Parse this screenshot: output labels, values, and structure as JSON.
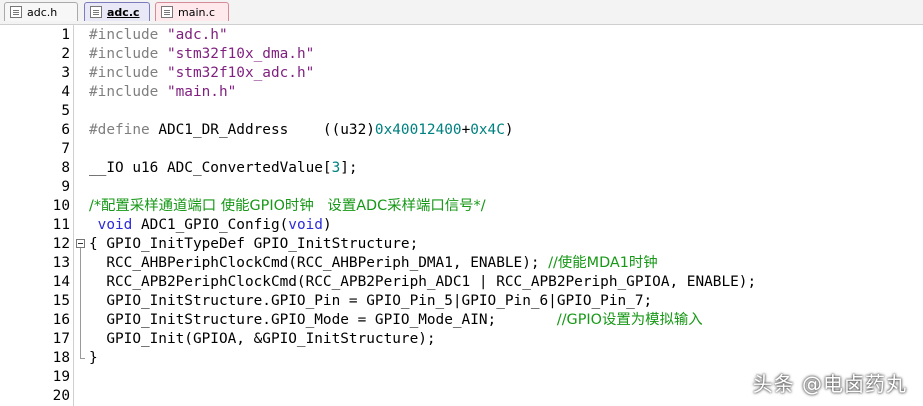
{
  "tabs": [
    {
      "label": "adc.h",
      "active": false
    },
    {
      "label": "adc.c",
      "active": true
    },
    {
      "label": "main.c",
      "active": false
    }
  ],
  "lines": [
    {
      "n": "1"
    },
    {
      "n": "2"
    },
    {
      "n": "3"
    },
    {
      "n": "4"
    },
    {
      "n": "5"
    },
    {
      "n": "6"
    },
    {
      "n": "7"
    },
    {
      "n": "8"
    },
    {
      "n": "9"
    },
    {
      "n": "10"
    },
    {
      "n": "11"
    },
    {
      "n": "12"
    },
    {
      "n": "13"
    },
    {
      "n": "14"
    },
    {
      "n": "15"
    },
    {
      "n": "16"
    },
    {
      "n": "17"
    },
    {
      "n": "18"
    },
    {
      "n": "19"
    },
    {
      "n": "20"
    }
  ],
  "code": {
    "l1_pp": "#include",
    "l1_str": "\"adc.h\"",
    "l2_pp": "#include",
    "l2_str": "\"stm32f10x_dma.h\"",
    "l3_pp": "#include",
    "l3_str": "\"stm32f10x_adc.h\"",
    "l4_pp": "#include",
    "l4_str": "\"main.h\"",
    "l6_pp": "#define",
    "l6_a": " ADC1_DR_Address    ((u32)",
    "l6_n1": "0x40012400",
    "l6_p": "+",
    "l6_n2": "0x4C",
    "l6_b": ")",
    "l8_a": "__IO u16 ADC_ConvertedValue[",
    "l8_n": "3",
    "l8_b": "];",
    "l10_cmt": "/*配置采样通道端口 使能GPIO时钟   设置ADC采样端口信号*/",
    "l11_kw1": "void",
    "l11_a": " ADC1_GPIO_Config(",
    "l11_kw2": "void",
    "l11_b": ")",
    "l12": "{ GPIO_InitTypeDef GPIO_InitStructure;",
    "l13_a": "  RCC_AHBPeriphClockCmd(RCC_AHBPeriph_DMA1, ENABLE); ",
    "l13_cmt": "//使能MDA1时钟",
    "l14": "  RCC_APB2PeriphClockCmd(RCC_APB2Periph_ADC1 | RCC_APB2Periph_GPIOA, ENABLE);",
    "l15": "  GPIO_InitStructure.GPIO_Pin = GPIO_Pin_5|GPIO_Pin_6|GPIO_Pin_7;",
    "l16_a": "  GPIO_InitStructure.GPIO_Mode = GPIO_Mode_AIN;       ",
    "l16_cmt": "//GPIO设置为模拟输入",
    "l17": "  GPIO_Init(GPIOA, &GPIO_InitStructure);",
    "l18": "}"
  },
  "watermark": "头条 @电卤药丸"
}
